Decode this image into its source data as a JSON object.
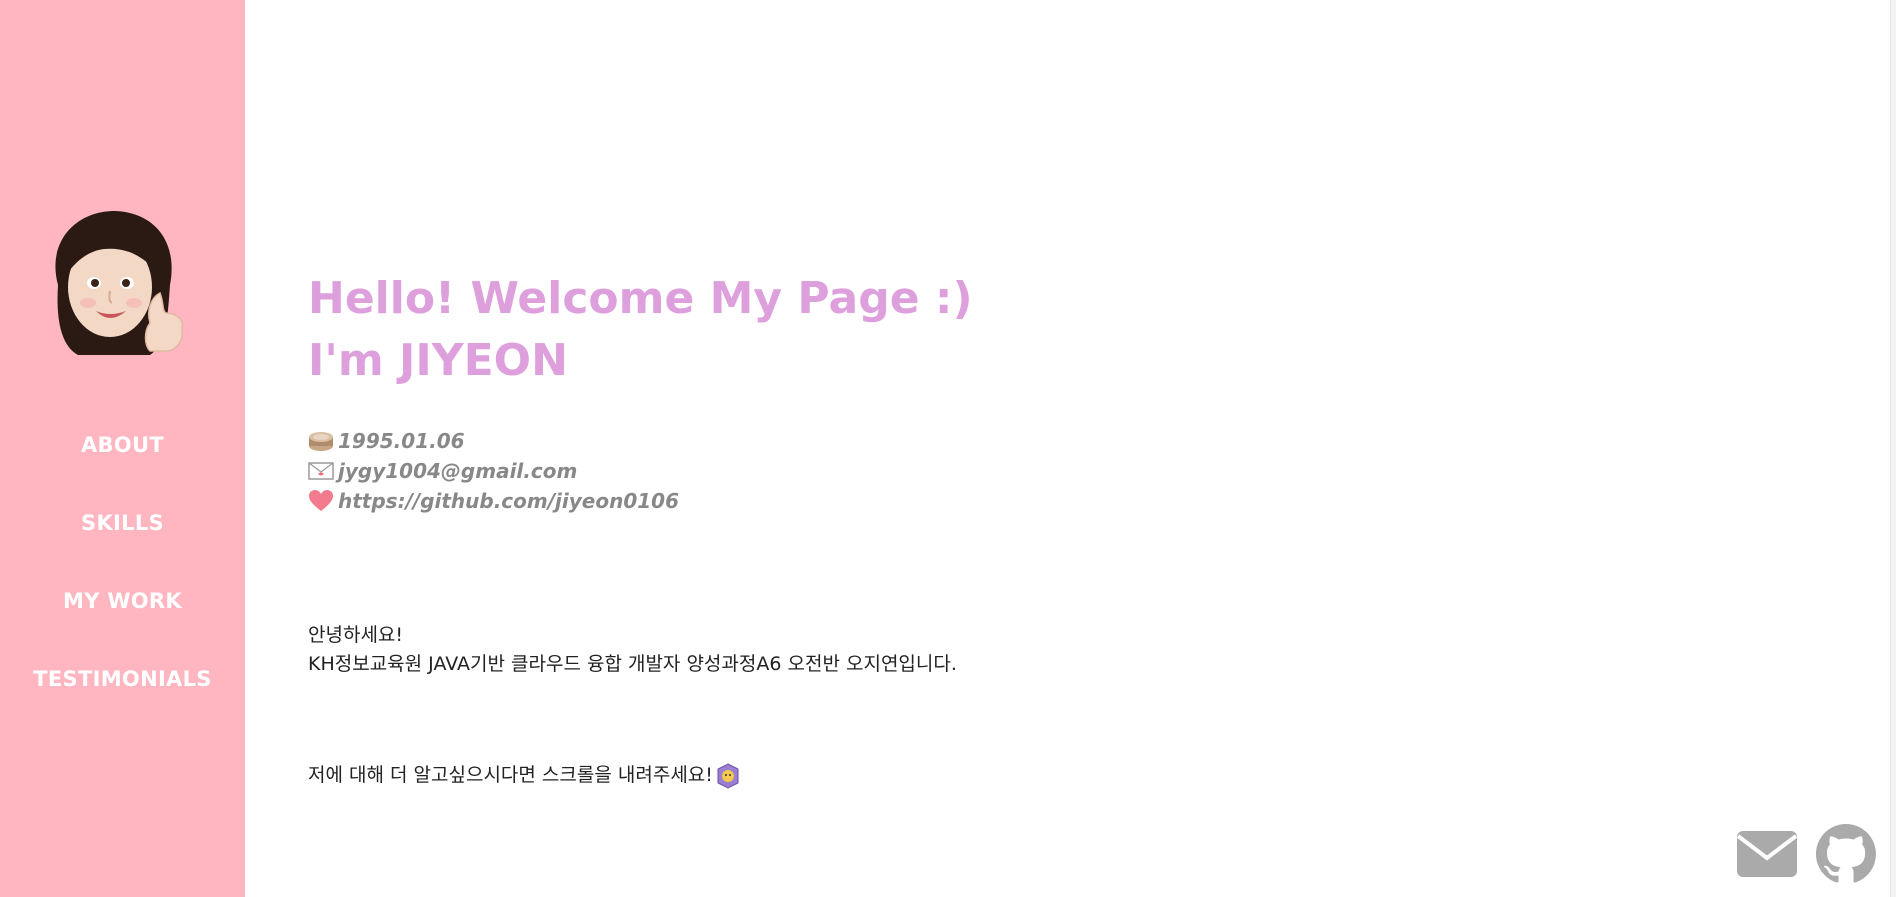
{
  "sidebar": {
    "avatar_icon": "memoji-thumbs-up-avatar",
    "nav": [
      {
        "label": "ABOUT"
      },
      {
        "label": "SKILLS"
      },
      {
        "label": "MY WORK"
      },
      {
        "label": "TESTIMONIALS"
      }
    ],
    "colors": {
      "background": "#ffb6c1",
      "text": "#ffffff"
    }
  },
  "main": {
    "headline_line1": "Hello! Welcome My Page :)",
    "headline_line2": "I'm JIYEON",
    "headline_color": "#dda0dd",
    "info": {
      "birthday": {
        "icon": "cake-icon",
        "text": "1995.01.06"
      },
      "email": {
        "icon": "envelope-icon",
        "text": "jygy1004@gmail.com"
      },
      "github": {
        "icon": "heart-icon",
        "text": "https://github.com/jiyeon0106"
      }
    },
    "intro_line1": "안녕하세요!",
    "intro_line2": "KH정보교육원 JAVA기반 클라우드 융합 개발자 양성과정A6 오전반 오지연입니다.",
    "cta_text": "저에 대해 더 알고싶으시다면 스크롤을 내려주세요!",
    "cta_icon": "lion-icon"
  },
  "social": {
    "mail_icon": "mail-icon",
    "github_icon": "github-icon",
    "icon_color": "#aaaaaa"
  }
}
